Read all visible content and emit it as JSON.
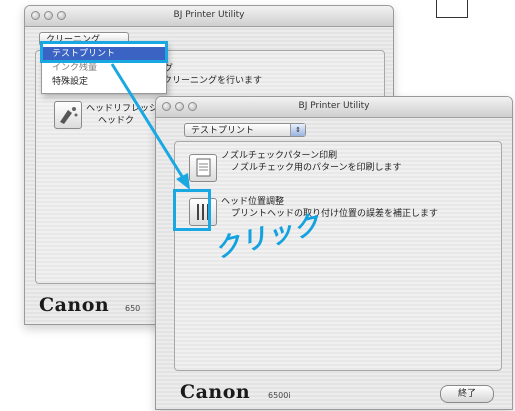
{
  "back_window": {
    "title": "BJ Printer Utility",
    "popup_label": "クリーニング",
    "row1_title": "グ",
    "row1_desc": "のクリーニングを行います",
    "row2_title": "ヘッドリフレッシング",
    "row2_desc": "ヘッドク",
    "brand": "Canon",
    "model": "650"
  },
  "menu": {
    "items": [
      "テストプリント",
      "インク残量",
      "特殊設定"
    ]
  },
  "front_window": {
    "title": "BJ Printer Utility",
    "popup_label": "テストプリント",
    "items": [
      {
        "title": "ノズルチェックパターン印刷",
        "desc": "ノズルチェック用のパターンを印刷します"
      },
      {
        "title": "ヘッド位置調整",
        "desc": "プリントヘッドの取り付け位置の誤差を補正します"
      }
    ],
    "brand": "Canon",
    "model": "6500i",
    "quit_label": "終了"
  },
  "annotation": {
    "click_text": "クリック",
    "color": "#1aa8e2"
  }
}
